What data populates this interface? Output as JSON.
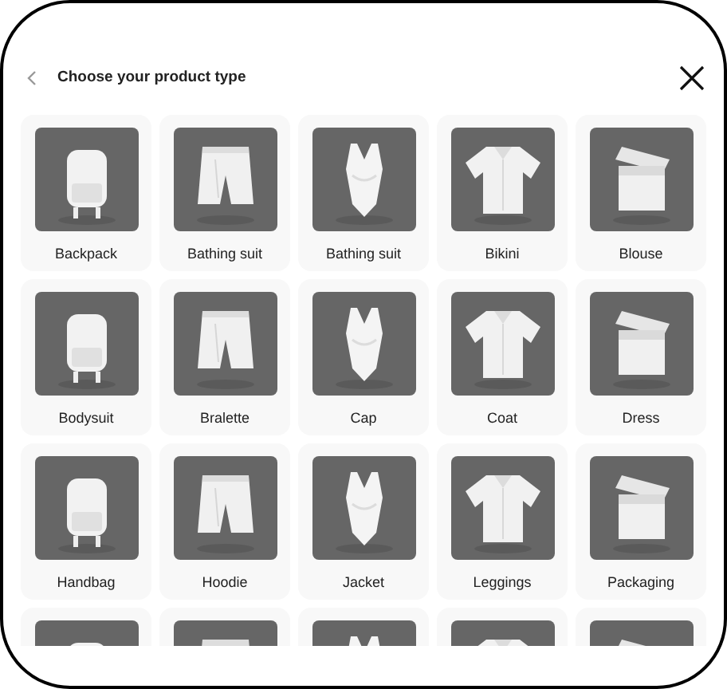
{
  "header": {
    "title": "Choose your product type"
  },
  "items": [
    {
      "kind": "product",
      "label": "Backpack"
    },
    {
      "kind": "product",
      "label": "Bathing suit"
    },
    {
      "kind": "product",
      "label": "Bathing suit"
    },
    {
      "kind": "product",
      "label": "Bikini"
    },
    {
      "kind": "product",
      "label": "Blouse"
    },
    {
      "kind": "product",
      "label": "Bodysuit"
    },
    {
      "kind": "product",
      "label": "Bralette"
    },
    {
      "kind": "product",
      "label": "Cap"
    },
    {
      "kind": "product",
      "label": "Coat"
    },
    {
      "kind": "product",
      "label": "Dress"
    },
    {
      "kind": "product",
      "label": "Handbag"
    },
    {
      "kind": "product",
      "label": "Hoodie"
    },
    {
      "kind": "product",
      "label": "Jacket"
    },
    {
      "kind": "product",
      "label": "Leggings"
    },
    {
      "kind": "product",
      "label": "Packaging"
    },
    {
      "kind": "cut"
    },
    {
      "kind": "cut"
    },
    {
      "kind": "cut"
    },
    {
      "kind": "cut"
    },
    {
      "kind": "cut"
    }
  ]
}
